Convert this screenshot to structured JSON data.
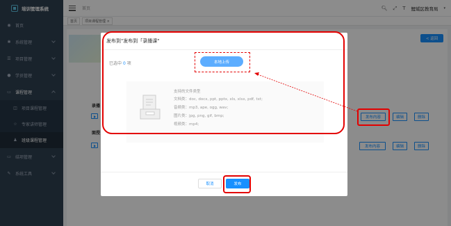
{
  "sidebar": {
    "brand": "培训管理系统",
    "items": [
      {
        "label": "首页",
        "icon": "dashboard-icon"
      },
      {
        "label": "系统管理",
        "icon": "gear-icon"
      },
      {
        "label": "项目管理",
        "icon": "list-icon"
      },
      {
        "label": "学员管理",
        "icon": "user-icon"
      },
      {
        "label": "课程管理",
        "icon": "monitor-icon"
      }
    ],
    "sub_items": [
      {
        "label": "项目课程管理",
        "icon": "book-icon"
      },
      {
        "label": "专家讲师管理",
        "icon": "star-icon"
      },
      {
        "label": "班级课程管理",
        "icon": "users-icon"
      }
    ],
    "items_after": [
      {
        "label": "结项管理",
        "icon": "monitor-icon"
      },
      {
        "label": "系统工具",
        "icon": "tool-icon"
      }
    ]
  },
  "header": {
    "breadcrumb_home": "首页",
    "user": "鲤城区教育局"
  },
  "tabs": [
    "首页",
    "项目课程管理 ×"
  ],
  "page": {
    "back_label": "< 返回",
    "section1": "录播",
    "section2": "面授",
    "btn_publish_content": "发布内容",
    "btn_edit": "编辑",
    "btn_delete": "删除"
  },
  "modal": {
    "title": "发布到\"发布到「录播课\"",
    "selected_prefix": "已选中",
    "selected_count": "0",
    "selected_suffix": "项",
    "upload_label": "本地上传",
    "types_title": "支持的文件类型",
    "type_lines": [
      "文档类：doc, docx, ppt, pptx, xls, xlsx, pdf, txt;",
      "音频类：mp3, ape, ogg, wav;",
      "图片类：jpg, png, gif, bmp;",
      "视频类：mp4;"
    ],
    "cancel_label": "取消",
    "publish_label": "发布"
  },
  "colors": {
    "sidebar_bg": "#2f4050",
    "primary": "#1890ff",
    "highlight": "#e30000"
  }
}
